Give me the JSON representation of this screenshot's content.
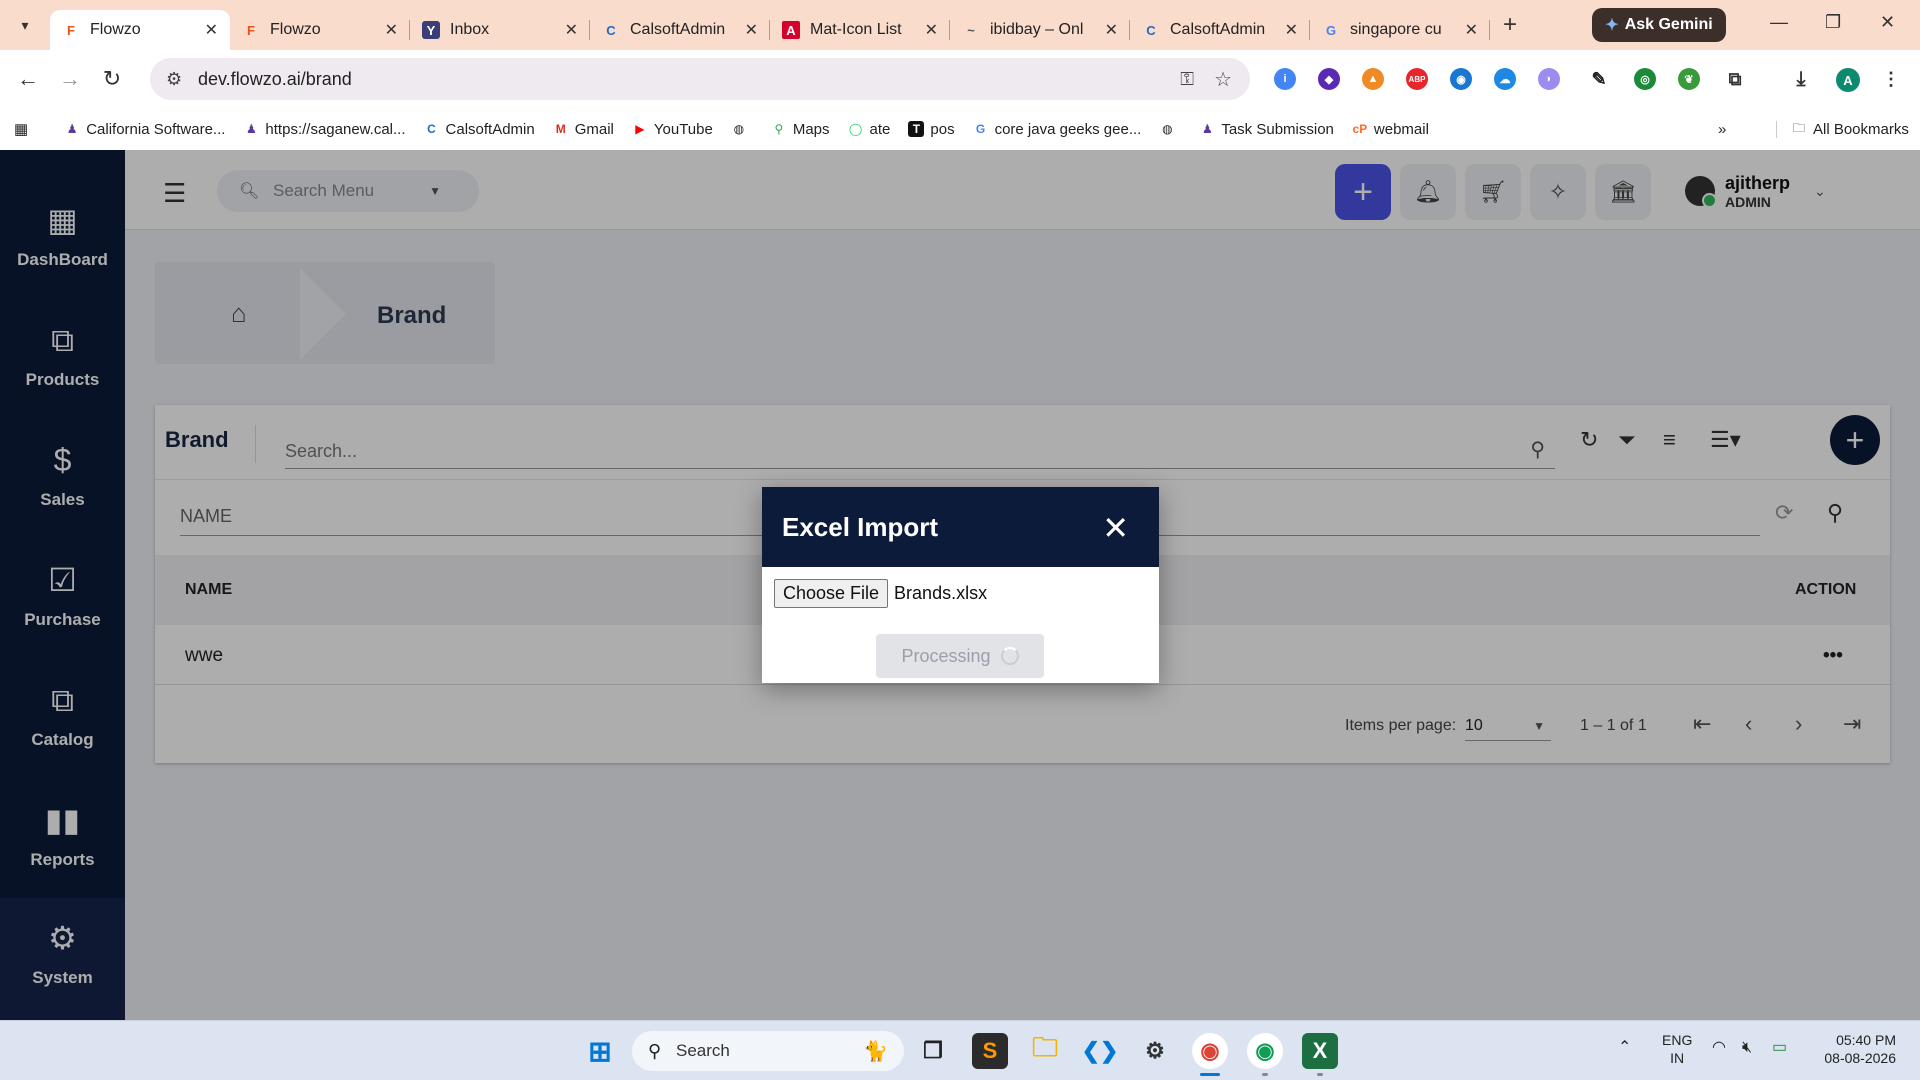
{
  "browser": {
    "tabs": [
      {
        "title": "Flowzo",
        "favicon": "F",
        "active": true
      },
      {
        "title": "Flowzo",
        "favicon": "F",
        "active": false
      },
      {
        "title": "Inbox",
        "favicon": "Y",
        "active": false
      },
      {
        "title": "CalsoftAdmin",
        "favicon": "C",
        "active": false
      },
      {
        "title": "Mat-Icon List",
        "favicon": "A",
        "active": false
      },
      {
        "title": "ibidbay – Onl",
        "favicon": "~",
        "active": false
      },
      {
        "title": "CalsoftAdmin",
        "favicon": "C",
        "active": false
      },
      {
        "title": "singapore cu",
        "favicon": "G",
        "active": false
      }
    ],
    "ask_gemini": "Ask Gemini",
    "url": "dev.flowzo.ai/brand",
    "profile_initial": "A",
    "bookmarks": [
      {
        "label": "California Software...",
        "icon": "figure-icon"
      },
      {
        "label": "https://saganew.cal...",
        "icon": "figure-icon"
      },
      {
        "label": "CalsoftAdmin",
        "icon": "calsoft-icon"
      },
      {
        "label": "Gmail",
        "icon": "gmail-icon"
      },
      {
        "label": "YouTube",
        "icon": "youtube-icon"
      },
      {
        "label": "",
        "icon": "globe-icon"
      },
      {
        "label": "Maps",
        "icon": "maps-icon"
      },
      {
        "label": "ate",
        "icon": "whatsapp-icon"
      },
      {
        "label": "pos",
        "icon": "notion-icon"
      },
      {
        "label": "core java geeks gee...",
        "icon": "google-icon"
      },
      {
        "label": "",
        "icon": "globe-icon"
      },
      {
        "label": "Task Submission",
        "icon": "figure-icon"
      },
      {
        "label": "webmail",
        "icon": "cpanel-icon"
      }
    ],
    "all_bookmarks": "All Bookmarks"
  },
  "sidebar": {
    "items": [
      {
        "label": "DashBoard",
        "icon": "dashboard-icon"
      },
      {
        "label": "Products",
        "icon": "products-icon"
      },
      {
        "label": "Sales",
        "icon": "dollar-icon"
      },
      {
        "label": "Purchase",
        "icon": "purchase-icon"
      },
      {
        "label": "Catalog",
        "icon": "catalog-icon"
      },
      {
        "label": "Reports",
        "icon": "bar-chart-icon"
      },
      {
        "label": "System",
        "icon": "gear-icon"
      }
    ]
  },
  "topbar": {
    "search_placeholder": "Search Menu",
    "user_name": "ajitherp",
    "user_role": "ADMIN"
  },
  "breadcrumb": {
    "title": "Brand"
  },
  "card": {
    "title": "Brand",
    "search_placeholder": "Search...",
    "name_filter_placeholder": "NAME",
    "columns": [
      "NAME",
      "ACTION"
    ],
    "rows": [
      {
        "name": "wwe",
        "action": "•••"
      }
    ],
    "items_per_page_label": "Items per page:",
    "items_per_page": "10",
    "range": "1 – 1 of 1"
  },
  "dialog": {
    "title": "Excel Import",
    "choose_file_label": "Choose File",
    "file_name": "Brands.xlsx",
    "processing_label": "Processing"
  },
  "taskbar": {
    "search_label": "Search",
    "lang_top": "ENG",
    "lang_bottom": "IN",
    "time": "05:40 PM",
    "date": "08-08-2026"
  },
  "colors": {
    "sidebar": "#0d1b3a",
    "primary_add": "#4b53e6",
    "dialog_header": "#0d1b3a"
  }
}
